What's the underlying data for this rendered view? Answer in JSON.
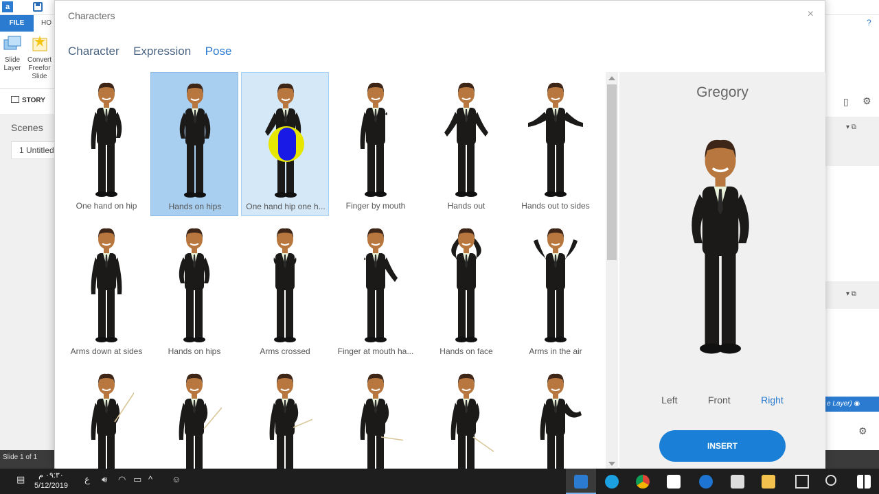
{
  "app": {
    "file_tab": "FILE",
    "home_tab": "HO",
    "ribbon_buttons": [
      {
        "label": "Slide\nLayer"
      },
      {
        "label": "Convert\nFreefor\nSlide"
      }
    ],
    "story_tab": "STORY",
    "scenes_label": "Scenes",
    "scene_item": "1 Untitled",
    "status_slide": "Slide 1 of 1",
    "layer_label": "e Layer)"
  },
  "dialog": {
    "title": "Characters",
    "close": "×",
    "tabs": [
      {
        "label": "Character",
        "active": false
      },
      {
        "label": "Expression",
        "active": false
      },
      {
        "label": "Pose",
        "active": true
      }
    ],
    "poses": [
      {
        "label": "One hand on hip",
        "pose": "onehip",
        "state": "normal"
      },
      {
        "label": "Hands on hips",
        "pose": "hips",
        "state": "selected"
      },
      {
        "label": "One hand hip one h...",
        "pose": "hiphand",
        "state": "hover"
      },
      {
        "label": "Finger by mouth",
        "pose": "finger",
        "state": "normal"
      },
      {
        "label": "Hands out",
        "pose": "out",
        "state": "normal"
      },
      {
        "label": "Hands out to sides",
        "pose": "outsides",
        "state": "normal"
      },
      {
        "label": "Arms down at sides",
        "pose": "down",
        "state": "normal"
      },
      {
        "label": "Hands on hips",
        "pose": "hips",
        "state": "normal"
      },
      {
        "label": "Arms crossed",
        "pose": "crossed",
        "state": "normal"
      },
      {
        "label": "Finger at mouth ha...",
        "pose": "finger2",
        "state": "normal"
      },
      {
        "label": "Hands on face",
        "pose": "face",
        "state": "normal"
      },
      {
        "label": "Arms in the air",
        "pose": "air",
        "state": "normal"
      },
      {
        "label": "",
        "pose": "pointer-up",
        "state": "normal"
      },
      {
        "label": "",
        "pose": "pointer-up2",
        "state": "normal"
      },
      {
        "label": "",
        "pose": "pointer-mid",
        "state": "normal"
      },
      {
        "label": "",
        "pose": "pointer-down",
        "state": "normal"
      },
      {
        "label": "",
        "pose": "pointer-down2",
        "state": "normal"
      },
      {
        "label": "",
        "pose": "present",
        "state": "normal"
      }
    ],
    "preview": {
      "name": "Gregory",
      "views": [
        {
          "label": "Left",
          "active": false
        },
        {
          "label": "Front",
          "active": false
        },
        {
          "label": "Right",
          "active": true
        }
      ],
      "insert_label": "INSERT"
    }
  },
  "taskbar": {
    "time": "٠٩:٣٠ م",
    "date": "5/12/2019",
    "lang": "ع"
  },
  "colors": {
    "accent": "#2b7bd0",
    "selected_bg": "#a8cff0",
    "hover_bg": "#d4e8f8",
    "suit": "#1c1a19",
    "skin": "#b8773e"
  }
}
